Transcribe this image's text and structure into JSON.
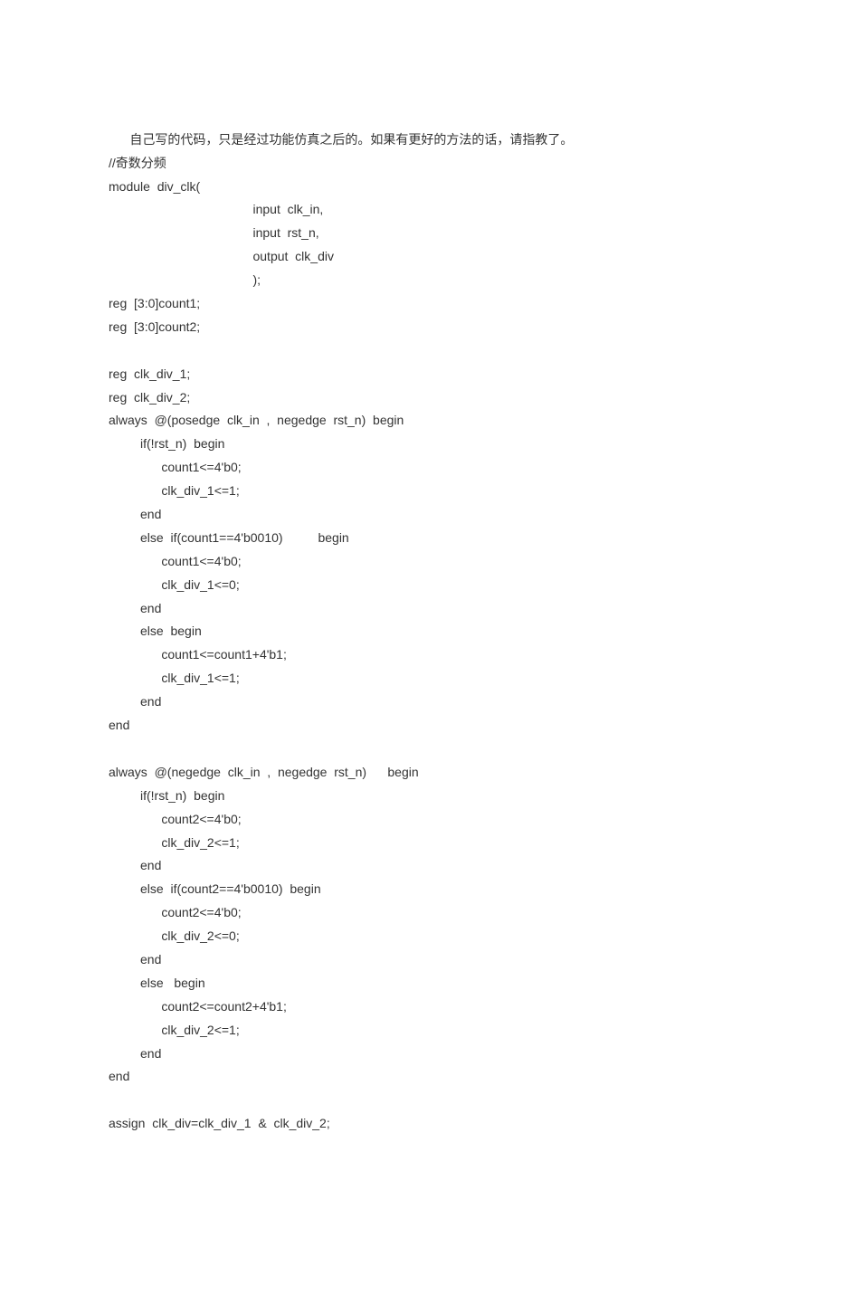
{
  "document": {
    "lines": [
      "      自己写的代码，只是经过功能仿真之后的。如果有更好的方法的话，请指教了。",
      "//奇数分频",
      "module  div_clk(",
      "                                         input  clk_in,",
      "                                         input  rst_n,",
      "                                         output  clk_div",
      "                                         );",
      "reg  [3:0]count1;",
      "reg  [3:0]count2;",
      "",
      "reg  clk_div_1;",
      "reg  clk_div_2;",
      "always  @(posedge  clk_in  ,  negedge  rst_n)  begin",
      "         if(!rst_n)  begin",
      "               count1<=4'b0;",
      "               clk_div_1<=1;",
      "         end",
      "         else  if(count1==4'b0010)          begin",
      "               count1<=4'b0;",
      "               clk_div_1<=0;",
      "         end",
      "         else  begin",
      "               count1<=count1+4'b1;",
      "               clk_div_1<=1;",
      "         end",
      "end",
      "",
      "always  @(negedge  clk_in  ,  negedge  rst_n)      begin",
      "         if(!rst_n)  begin",
      "               count2<=4'b0;",
      "               clk_div_2<=1;",
      "         end",
      "         else  if(count2==4'b0010)  begin",
      "               count2<=4'b0;",
      "               clk_div_2<=0;",
      "         end",
      "         else   begin",
      "               count2<=count2+4'b1;",
      "               clk_div_2<=1;",
      "         end",
      "end",
      "",
      "assign  clk_div=clk_div_1  &  clk_div_2;"
    ]
  }
}
